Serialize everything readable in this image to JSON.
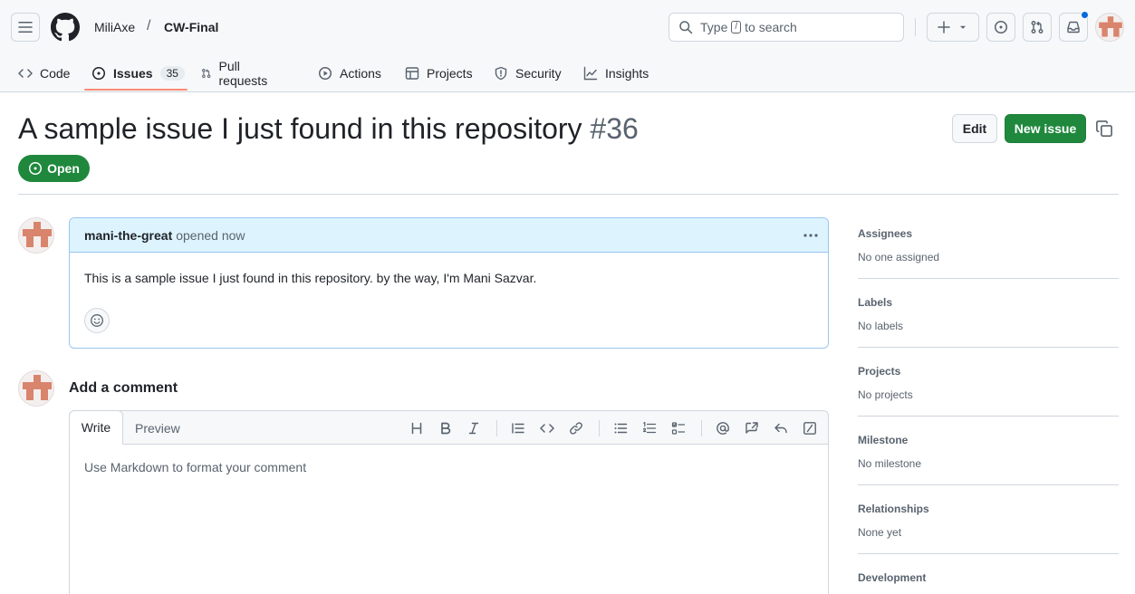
{
  "header": {
    "owner": "MiliAxe",
    "separator": "/",
    "repo": "CW-Final",
    "search": {
      "prefix": "Type",
      "key": "/",
      "suffix": "to search"
    },
    "icons": [
      "hamburger-icon",
      "github-logo",
      "search-icon",
      "plus-icon",
      "triangle-down-icon",
      "issue-opened-icon",
      "git-pull-request-icon",
      "inbox-icon"
    ]
  },
  "tabs": [
    {
      "label": "Code",
      "icon": "code-icon"
    },
    {
      "label": "Issues",
      "icon": "issue-opened-icon",
      "count": "35",
      "selected": true
    },
    {
      "label": "Pull requests",
      "icon": "git-pull-request-icon"
    },
    {
      "label": "Actions",
      "icon": "play-icon"
    },
    {
      "label": "Projects",
      "icon": "table-icon"
    },
    {
      "label": "Security",
      "icon": "shield-icon"
    },
    {
      "label": "Insights",
      "icon": "graph-icon"
    }
  ],
  "issue": {
    "title": "A sample issue I just found in this repository",
    "number": "#36",
    "state": "Open",
    "edit_label": "Edit",
    "new_issue_label": "New issue"
  },
  "comment": {
    "author": "mani-the-great",
    "meta": "opened now",
    "body": "This is a sample issue I just found in this repository. by the way, I'm Mani Sazvar."
  },
  "composer": {
    "heading": "Add a comment",
    "tab_write": "Write",
    "tab_preview": "Preview",
    "placeholder": "Use Markdown to format your comment",
    "toolbar": [
      "heading-icon",
      "bold-icon",
      "italic-icon",
      "quote-icon",
      "code-icon",
      "link-icon",
      "list-unordered-icon",
      "list-ordered-icon",
      "tasklist-icon",
      "mention-icon",
      "cross-reference-icon",
      "reply-icon",
      "slash-command-icon"
    ]
  },
  "sidebar": [
    {
      "title": "Assignees",
      "value": "No one assigned"
    },
    {
      "title": "Labels",
      "value": "No labels"
    },
    {
      "title": "Projects",
      "value": "No projects"
    },
    {
      "title": "Milestone",
      "value": "No milestone"
    },
    {
      "title": "Relationships",
      "value": "None yet"
    },
    {
      "title": "Development",
      "value": ""
    }
  ],
  "colors": {
    "accent_green": "#1f883d",
    "link_blue": "#0969da",
    "tab_underline": "#fd8c73",
    "comment_header_bg": "#ddf4ff",
    "avatar_color": "#d9846c"
  }
}
